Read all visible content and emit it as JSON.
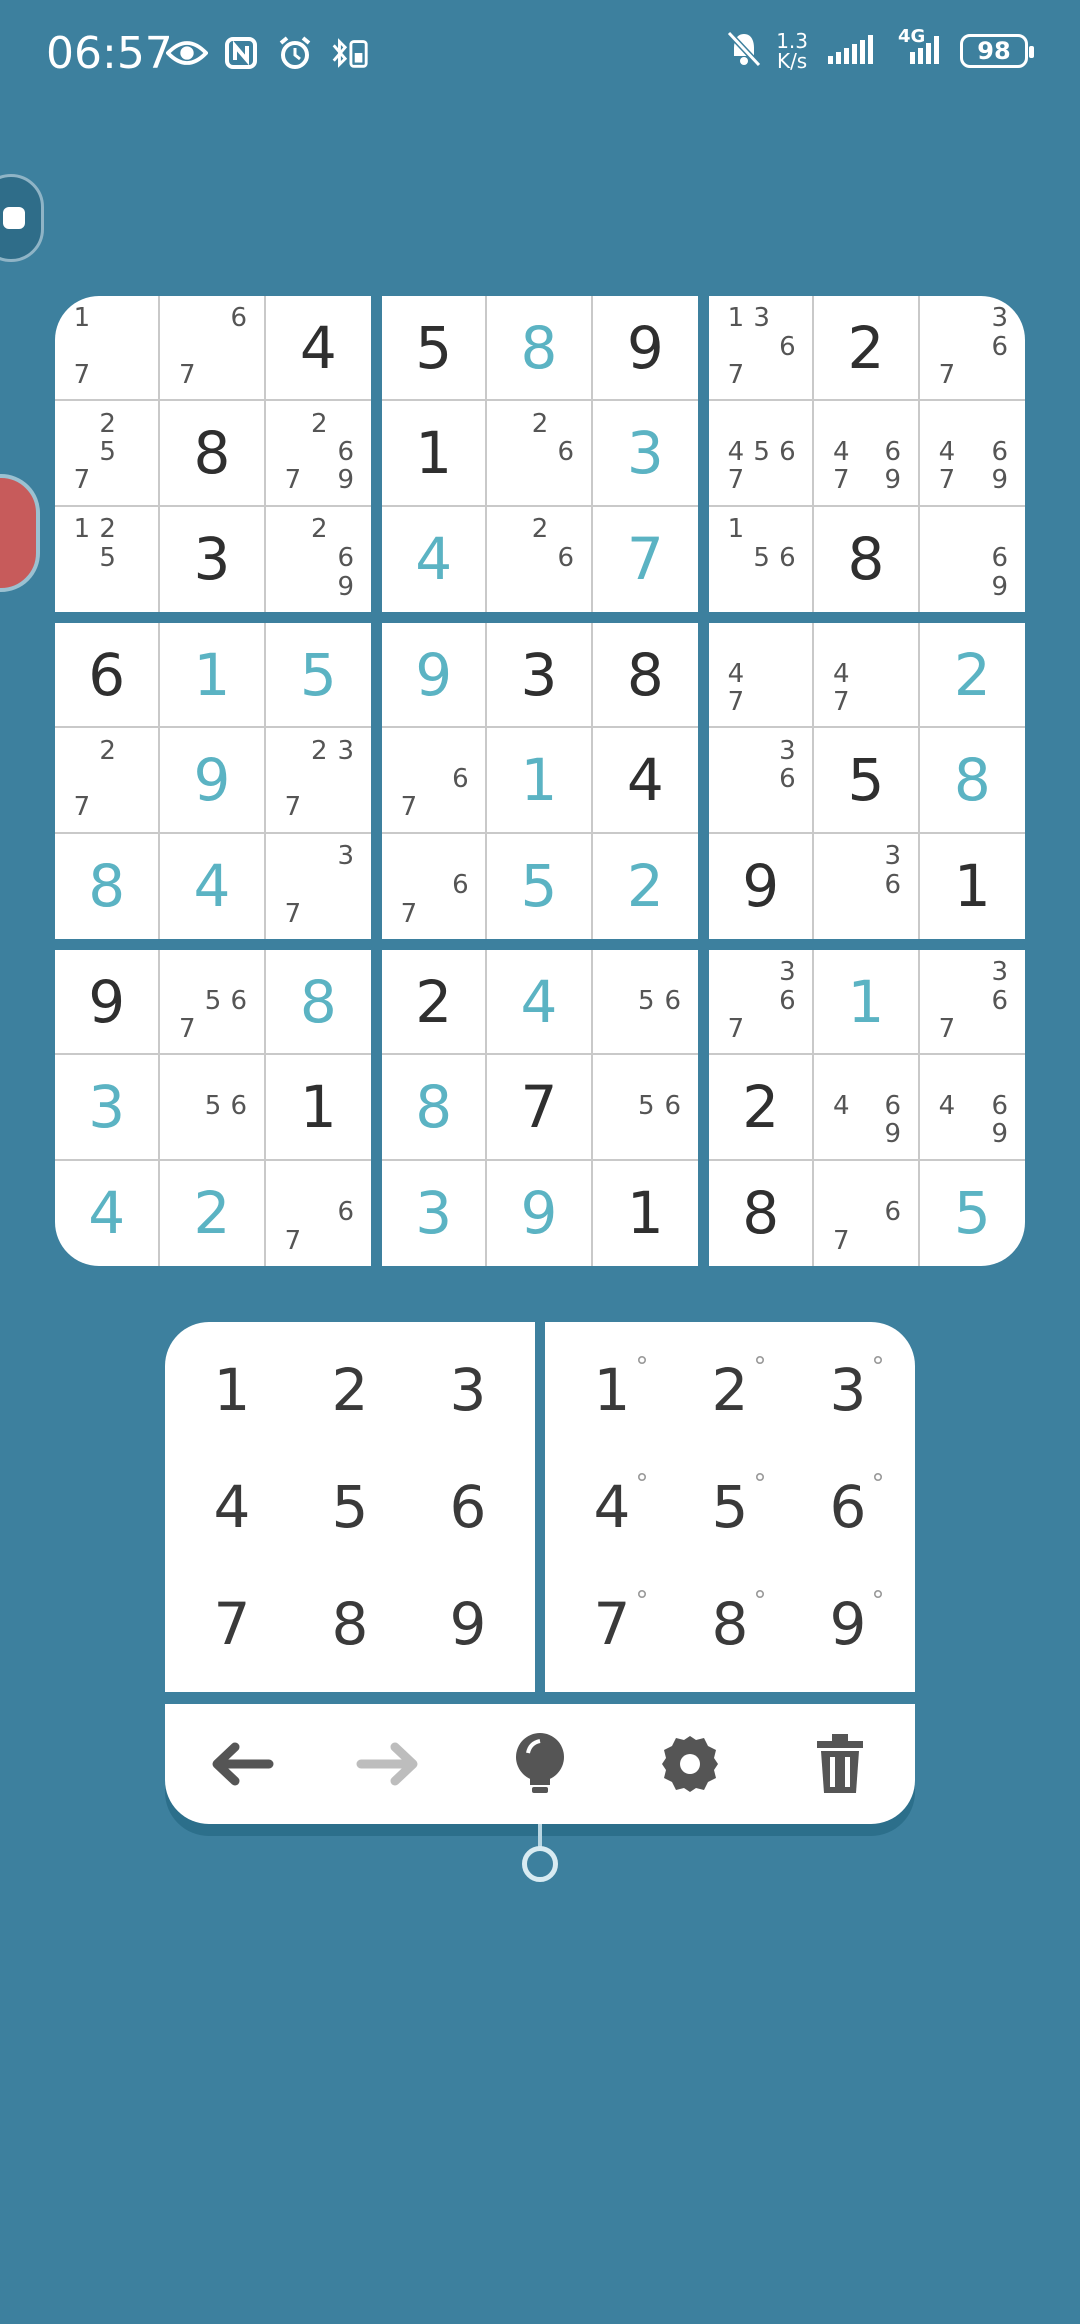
{
  "status_bar": {
    "time": "06:57",
    "left_icons": [
      "eye-icon",
      "nfc-icon",
      "alarm-icon",
      "bluetooth-battery-icon"
    ],
    "net_speed_value": "1.3",
    "net_speed_unit": "K/s",
    "network_label": "4G",
    "battery": "98"
  },
  "board": {
    "boxes": [
      [
        {
          "notes": [
            "1",
            "",
            "",
            "",
            "",
            "",
            "7",
            "",
            ""
          ]
        },
        {
          "notes": [
            "",
            "",
            "6",
            "",
            "",
            "",
            "7",
            "",
            ""
          ]
        },
        {
          "value": "4",
          "kind": "given"
        },
        {
          "notes": [
            "",
            "2",
            "",
            "",
            "5",
            "",
            "7",
            "",
            ""
          ]
        },
        {
          "value": "8",
          "kind": "given"
        },
        {
          "notes": [
            "",
            "2",
            "",
            "",
            "",
            "6",
            "7",
            "",
            "9"
          ]
        },
        {
          "notes": [
            "1",
            "2",
            "",
            "",
            "5",
            "",
            "",
            "",
            ""
          ]
        },
        {
          "value": "3",
          "kind": "given"
        },
        {
          "notes": [
            "",
            "2",
            "",
            "",
            "",
            "6",
            "",
            "",
            "9"
          ]
        }
      ],
      [
        {
          "value": "5",
          "kind": "given"
        },
        {
          "value": "8",
          "kind": "user"
        },
        {
          "value": "9",
          "kind": "given"
        },
        {
          "value": "1",
          "kind": "given"
        },
        {
          "notes": [
            "",
            "2",
            "",
            "",
            "",
            "6",
            "",
            "",
            ""
          ]
        },
        {
          "value": "3",
          "kind": "user"
        },
        {
          "value": "4",
          "kind": "user"
        },
        {
          "notes": [
            "",
            "2",
            "",
            "",
            "",
            "6",
            "",
            "",
            ""
          ]
        },
        {
          "value": "7",
          "kind": "user"
        }
      ],
      [
        {
          "notes": [
            "1",
            "3",
            "",
            "",
            "",
            "6",
            "7",
            "",
            ""
          ]
        },
        {
          "value": "2",
          "kind": "given"
        },
        {
          "notes": [
            "",
            "",
            "3",
            "",
            "",
            "6",
            "7",
            "",
            ""
          ]
        },
        {
          "notes": [
            "",
            "",
            "",
            "4",
            "5",
            "6",
            "7",
            "",
            ""
          ]
        },
        {
          "notes": [
            "",
            "",
            "",
            "4",
            "",
            "6",
            "7",
            "",
            "9"
          ]
        },
        {
          "notes": [
            "",
            "",
            "",
            "4",
            "",
            "6",
            "7",
            "",
            "9"
          ]
        },
        {
          "notes": [
            "1",
            "",
            "",
            "",
            "5",
            "6",
            "",
            "",
            ""
          ]
        },
        {
          "value": "8",
          "kind": "given"
        },
        {
          "notes": [
            "",
            "",
            "",
            "",
            "",
            "6",
            "",
            "",
            "9"
          ]
        }
      ],
      [
        {
          "value": "6",
          "kind": "given"
        },
        {
          "value": "1",
          "kind": "user"
        },
        {
          "value": "5",
          "kind": "user"
        },
        {
          "notes": [
            "",
            "2",
            "",
            "",
            "",
            "",
            "7",
            "",
            ""
          ]
        },
        {
          "value": "9",
          "kind": "user"
        },
        {
          "notes": [
            "",
            "2",
            "3",
            "",
            "",
            "",
            "7",
            "",
            ""
          ]
        },
        {
          "value": "8",
          "kind": "user"
        },
        {
          "value": "4",
          "kind": "user"
        },
        {
          "notes": [
            "",
            "",
            "3",
            "",
            "",
            "",
            "7",
            "",
            ""
          ]
        }
      ],
      [
        {
          "value": "9",
          "kind": "user"
        },
        {
          "value": "3",
          "kind": "given"
        },
        {
          "value": "8",
          "kind": "given"
        },
        {
          "notes": [
            "",
            "",
            "",
            "",
            "",
            "6",
            "7",
            "",
            ""
          ]
        },
        {
          "value": "1",
          "kind": "user"
        },
        {
          "value": "4",
          "kind": "given"
        },
        {
          "notes": [
            "",
            "",
            "",
            "",
            "",
            "6",
            "7",
            "",
            ""
          ]
        },
        {
          "value": "5",
          "kind": "user"
        },
        {
          "value": "2",
          "kind": "user"
        }
      ],
      [
        {
          "notes": [
            "",
            "",
            "",
            "4",
            "",
            "",
            "7",
            "",
            ""
          ]
        },
        {
          "notes": [
            "",
            "",
            "",
            "4",
            "",
            "",
            "7",
            "",
            ""
          ]
        },
        {
          "value": "2",
          "kind": "user"
        },
        {
          "notes": [
            "",
            "",
            "3",
            "",
            "",
            "6",
            "",
            "",
            ""
          ]
        },
        {
          "value": "5",
          "kind": "given"
        },
        {
          "value": "8",
          "kind": "user"
        },
        {
          "value": "9",
          "kind": "given"
        },
        {
          "notes": [
            "",
            "",
            "3",
            "",
            "",
            "6",
            "",
            "",
            ""
          ]
        },
        {
          "value": "1",
          "kind": "given"
        }
      ],
      [
        {
          "value": "9",
          "kind": "given"
        },
        {
          "notes": [
            "",
            "",
            "",
            "",
            "5",
            "6",
            "7",
            "",
            ""
          ]
        },
        {
          "value": "8",
          "kind": "user"
        },
        {
          "value": "3",
          "kind": "user"
        },
        {
          "notes": [
            "",
            "",
            "",
            "",
            "5",
            "6",
            "",
            "",
            ""
          ]
        },
        {
          "value": "1",
          "kind": "given"
        },
        {
          "value": "4",
          "kind": "user"
        },
        {
          "value": "2",
          "kind": "user"
        },
        {
          "notes": [
            "",
            "",
            "",
            "",
            "",
            "6",
            "7",
            "",
            ""
          ]
        }
      ],
      [
        {
          "value": "2",
          "kind": "given"
        },
        {
          "value": "4",
          "kind": "user"
        },
        {
          "notes": [
            "",
            "",
            "",
            "",
            "5",
            "6",
            "",
            "",
            ""
          ]
        },
        {
          "value": "8",
          "kind": "user"
        },
        {
          "value": "7",
          "kind": "given"
        },
        {
          "notes": [
            "",
            "",
            "",
            "",
            "5",
            "6",
            "",
            "",
            ""
          ]
        },
        {
          "value": "3",
          "kind": "user"
        },
        {
          "value": "9",
          "kind": "user"
        },
        {
          "value": "1",
          "kind": "given"
        }
      ],
      [
        {
          "notes": [
            "",
            "",
            "3",
            "",
            "",
            "6",
            "7",
            "",
            ""
          ]
        },
        {
          "value": "1",
          "kind": "user"
        },
        {
          "notes": [
            "",
            "",
            "3",
            "",
            "",
            "6",
            "7",
            "",
            ""
          ]
        },
        {
          "value": "2",
          "kind": "given"
        },
        {
          "notes": [
            "",
            "",
            "",
            "4",
            "",
            "6",
            "",
            "",
            "9"
          ]
        },
        {
          "notes": [
            "",
            "",
            "",
            "4",
            "",
            "6",
            "",
            "",
            "9"
          ]
        },
        {
          "value": "8",
          "kind": "given"
        },
        {
          "notes": [
            "",
            "",
            "",
            "",
            "",
            "6",
            "7",
            "",
            ""
          ]
        },
        {
          "value": "5",
          "kind": "user"
        }
      ]
    ]
  },
  "number_pad": {
    "keys": [
      "1",
      "2",
      "3",
      "4",
      "5",
      "6",
      "7",
      "8",
      "9"
    ]
  },
  "notes_pad": {
    "keys": [
      "1",
      "2",
      "3",
      "4",
      "5",
      "6",
      "7",
      "8",
      "9"
    ],
    "marker": "°"
  },
  "toolbar": {
    "tools": [
      "undo-arrow-icon",
      "redo-arrow-icon",
      "hint-bulb-icon",
      "settings-gear-icon",
      "trash-icon"
    ],
    "colors": {
      "active": "#555555",
      "disabled": "#bdbdbd"
    }
  },
  "theme": {
    "background": "#3d809e",
    "given_digit": "#2f2f2f",
    "user_digit": "#5bb3c3",
    "note_digit": "#555555"
  }
}
